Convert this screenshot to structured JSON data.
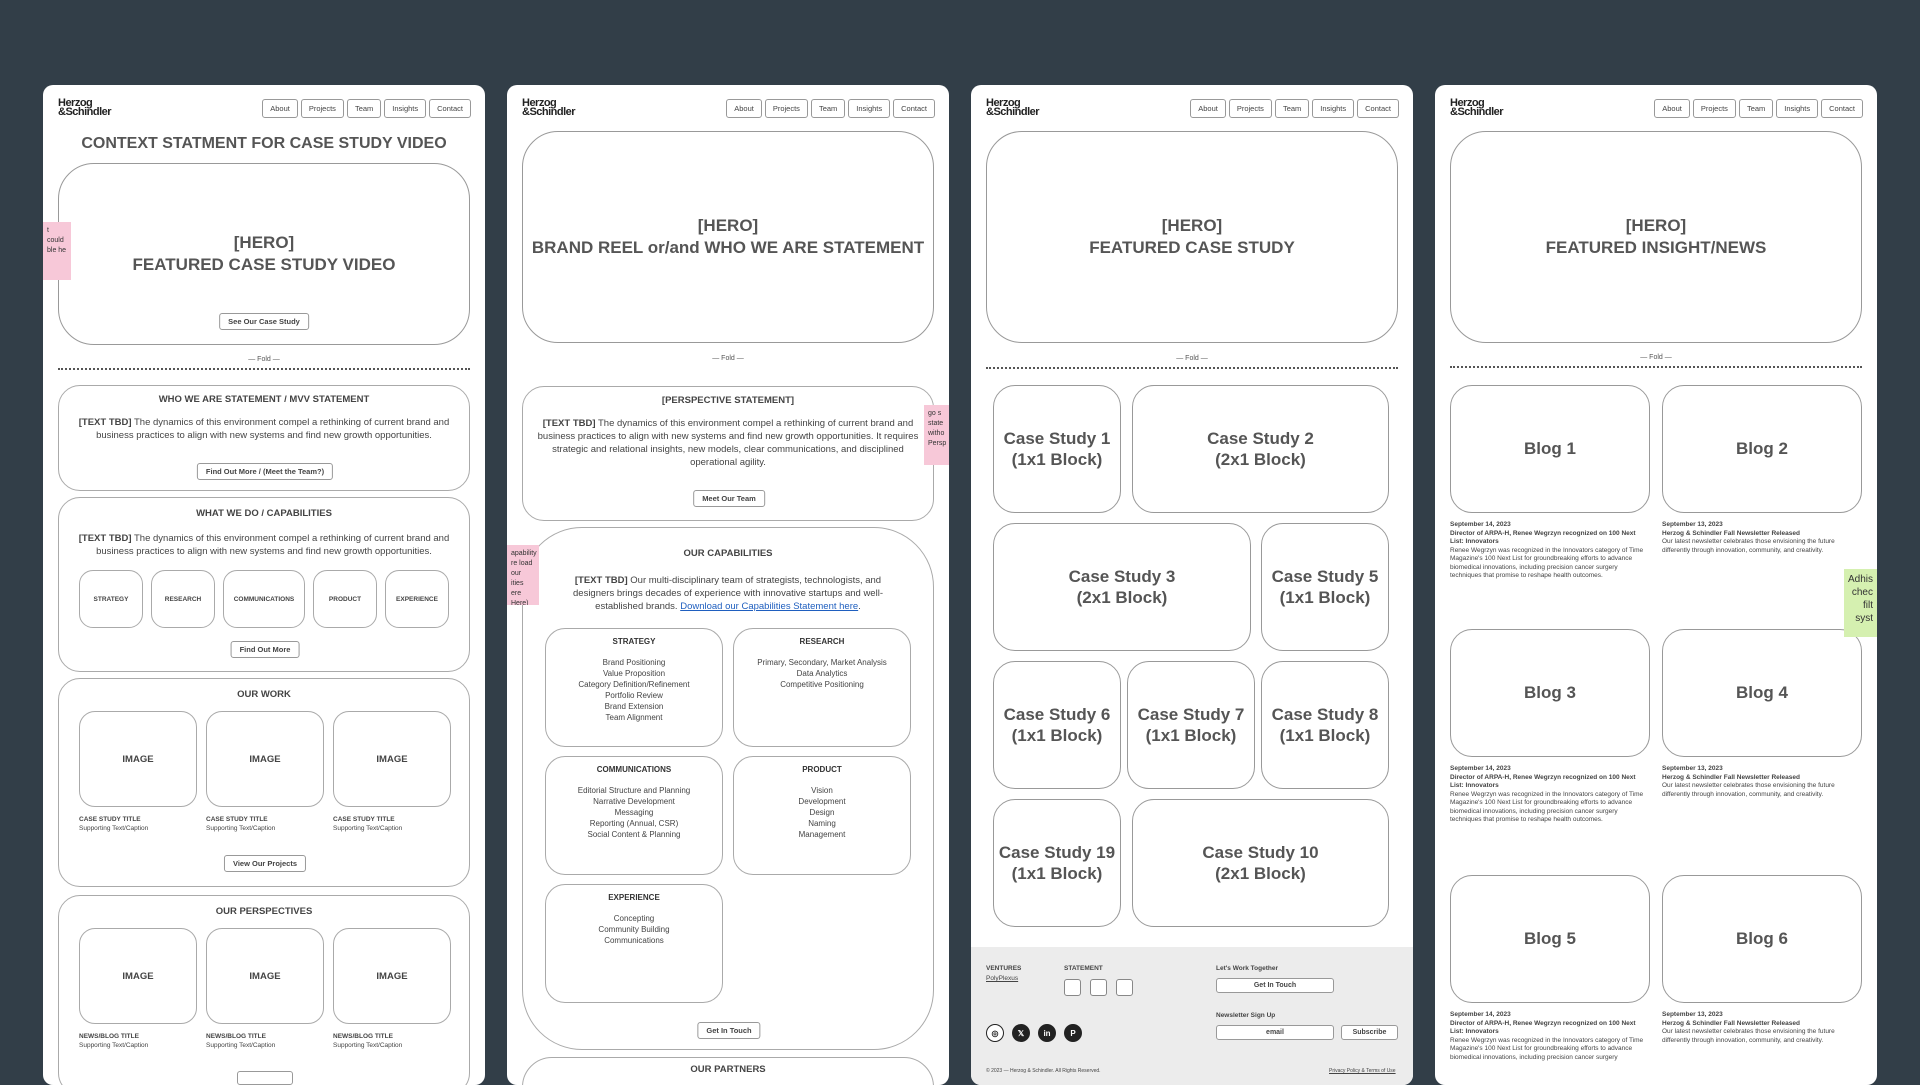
{
  "brand": {
    "logo_line1": "Herzog",
    "logo_line2": "&Schindler"
  },
  "nav": [
    "About",
    "Projects",
    "Team",
    "Insights",
    "Contact"
  ],
  "fold_label": "— Fold —",
  "panel1": {
    "context_title": "CONTEXT STATMENT FOR CASE STUDY VIDEO",
    "hero_line1": "[HERO]",
    "hero_line2": "FEATURED CASE STUDY VIDEO",
    "hero_button": "See Our Case Study",
    "sticky_text": "t could ble he",
    "who_title": "WHO WE ARE STATEMENT / MVV STATEMENT",
    "tbd": "[TEXT TBD]",
    "who_text": " The dynamics of this environment compel a rethinking of current brand and business practices to align with new systems and find new growth opportunities.",
    "who_button": "Find Out More / (Meet the Team?)",
    "what_title": "WHAT WE DO / CAPABILITIES",
    "what_text": " The dynamics of this environment compel a rethinking of current brand and business practices to align with new systems and find new growth opportunities.",
    "capabilities": [
      "STRATEGY",
      "RESEARCH",
      "COMMUNICATIONS",
      "PRODUCT",
      "EXPERIENCE"
    ],
    "what_button": "Find Out More",
    "work_title": "OUR WORK",
    "image_label": "IMAGE",
    "case_title": "CASE STUDY TITLE",
    "caption": "Supporting Text/Caption",
    "work_button": "View Our Projects",
    "persp_title": "OUR PERSPECTIVES",
    "news_title": "NEWS/BLOG TITLE"
  },
  "panel2": {
    "hero_line1": "[HERO]",
    "hero_line2": "BRAND REEL or/and WHO WE ARE STATEMENT",
    "persp_title": "[PERSPECTIVE STATEMENT]",
    "tbd": "[TEXT TBD]",
    "persp_text": " The dynamics of this environment compel a rethinking of current brand and business practices to align with new systems and find new growth opportunities. It requires strategic and relational insights, new models, clear communications, and disciplined operational agility.",
    "persp_button": "Meet Our Team",
    "sticky_right": "go s state witho Persp",
    "sticky_left": "apability re load our ities ere Here)",
    "cap_title": "OUR CAPABILITIES",
    "cap_text": " Our multi-disciplinary team of strategists, technologists, and designers brings decades of experience with innovative startups and well-established brands. ",
    "cap_link": "Download our Capabilities Statement here",
    "boxes": [
      {
        "title": "STRATEGY",
        "items": [
          "Brand Positioning",
          "Value Proposition",
          "Category Definition/Refinement",
          "Portfolio Review",
          "Brand Extension",
          "Team Alignment"
        ]
      },
      {
        "title": "RESEARCH",
        "items": [
          "Primary, Secondary, Market Analysis",
          "Data Analytics",
          "Competitive Positioning"
        ]
      },
      {
        "title": "COMMUNICATIONS",
        "items": [
          "Editorial Structure and Planning",
          "Narrative Development",
          "Messaging",
          "Reporting (Annual, CSR)",
          "Social Content & Planning"
        ]
      },
      {
        "title": "PRODUCT",
        "items": [
          "Vision",
          "Development",
          "Design",
          "Naming",
          "Management"
        ]
      },
      {
        "title": "EXPERIENCE",
        "items": [
          "Concepting",
          "Community Building",
          "Communications"
        ]
      }
    ],
    "cap_button": "Get In Touch",
    "partners_title": "OUR PARTNERS"
  },
  "panel3": {
    "hero_line1": "[HERO]",
    "hero_line2": "FEATURED CASE STUDY",
    "cases": [
      {
        "l1": "Case Study 1",
        "l2": "(1x1 Block)"
      },
      {
        "l1": "Case Study 2",
        "l2": "(2x1 Block)"
      },
      {
        "l1": "Case Study 3",
        "l2": "(2x1 Block)"
      },
      {
        "l1": "Case Study 5",
        "l2": "(1x1 Block)"
      },
      {
        "l1": "Case Study 6",
        "l2": "(1x1 Block)"
      },
      {
        "l1": "Case Study 7",
        "l2": "(1x1 Block)"
      },
      {
        "l1": "Case Study 8",
        "l2": "(1x1 Block)"
      },
      {
        "l1": "Case Study 19",
        "l2": "(1x1 Block)"
      },
      {
        "l1": "Case Study 10",
        "l2": "(2x1 Block)"
      }
    ],
    "footer": {
      "ventures": "VENTURES",
      "polyplexus": "PolyPlexus",
      "statement": "STATEMENT",
      "work_together": "Let's Work Together",
      "get_in_touch": "Get In Touch",
      "newsletter": "Newsletter Sign Up",
      "email_placeholder": "email",
      "subscribe": "Subscribe",
      "copyright": "© 2023 — Herzog & Schindler. All Rights Reserved.",
      "privacy": "Privacy Policy & Terms of Use",
      "social": [
        "instagram-icon",
        "x-icon",
        "linkedin-icon",
        "pinterest-icon"
      ]
    }
  },
  "panel4": {
    "hero_line1": "[HERO]",
    "hero_line2": "FEATURED INSIGHT/NEWS",
    "sticky_text": "Adhis chec filt syst",
    "blogs": [
      {
        "label": "Blog 1",
        "date": "September 14, 2023",
        "title": "Director of ARPA-H, Renee Wegrzyn recognized on 100 Next List: Innovators",
        "body": "Renee Wegrzyn was recognized in the Innovators category of Time Magazine's 100 Next List for groundbreaking efforts to advance biomedical innovations, including precision cancer surgery techniques that promise to reshape health outcomes."
      },
      {
        "label": "Blog 2",
        "date": "September 13, 2023",
        "title": "Herzog & Schindler Fall Newsletter Released",
        "body": "Our latest newsletter celebrates those envisioning the future differently through innovation, community, and creativity."
      },
      {
        "label": "Blog 3",
        "date": "September 14, 2023",
        "title": "Director of ARPA-H, Renee Wegrzyn recognized on 100 Next List: Innovators",
        "body": "Renee Wegrzyn was recognized in the Innovators category of Time Magazine's 100 Next List for groundbreaking efforts to advance biomedical innovations, including precision cancer surgery techniques that promise to reshape health outcomes."
      },
      {
        "label": "Blog 4",
        "date": "September 13, 2023",
        "title": "Herzog & Schindler Fall Newsletter Released",
        "body": "Our latest newsletter celebrates those envisioning the future differently through innovation, community, and creativity."
      },
      {
        "label": "Blog 5",
        "date": "September 14, 2023",
        "title": "Director of ARPA-H, Renee Wegrzyn recognized on 100 Next List: Innovators",
        "body": "Renee Wegrzyn was recognized in the Innovators category of Time Magazine's 100 Next List for groundbreaking efforts to advance biomedical innovations, including precision cancer surgery"
      },
      {
        "label": "Blog 6",
        "date": "September 13, 2023",
        "title": "Herzog & Schindler Fall Newsletter Released",
        "body": "Our latest newsletter celebrates those envisioning the future differently through innovation, community, and creativity."
      }
    ]
  },
  "colors": {
    "background": "#323e48",
    "panel": "#ffffff",
    "sticky_pink": "#f7c8d8",
    "sticky_green": "#d5f0b0",
    "link": "#1f5fbf"
  }
}
